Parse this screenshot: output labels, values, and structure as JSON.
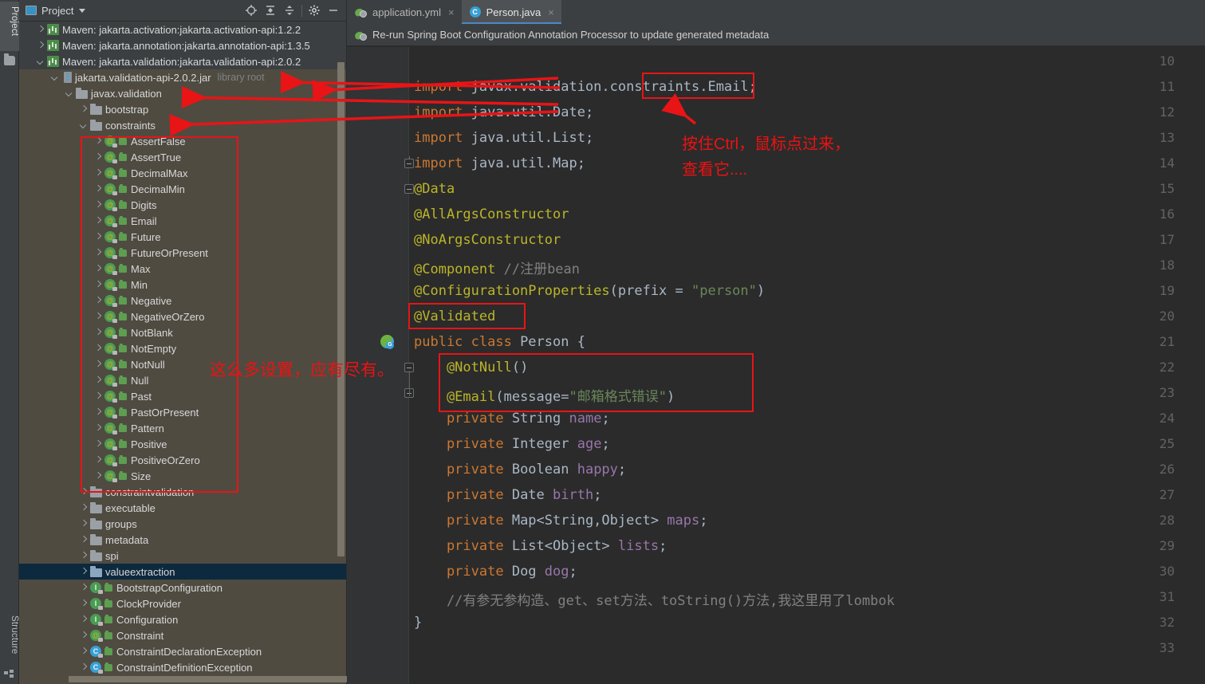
{
  "rail": {
    "top_tab": "Project",
    "bottom_tab": "Structure",
    "folder_icon": "folder-icon",
    "structure_icon": "structure-icon"
  },
  "project_panel": {
    "title": "Project",
    "toolbar": [
      {
        "name": "select-opened-file-icon",
        "glyph": "target"
      },
      {
        "name": "expand-all-icon",
        "glyph": "expand"
      },
      {
        "name": "collapse-all-icon",
        "glyph": "collapse"
      },
      {
        "name": "settings-gear-icon",
        "glyph": "gear"
      },
      {
        "name": "hide-panel-icon",
        "glyph": "minus"
      }
    ],
    "tree": [
      {
        "label": "Maven: jakarta.activation:jakarta.activation-api:1.2.2",
        "indent": 0,
        "arrow": "right",
        "icon": "maven",
        "bg": "dark"
      },
      {
        "label": "Maven: jakarta.annotation:jakarta.annotation-api:1.3.5",
        "indent": 0,
        "arrow": "right",
        "icon": "maven",
        "bg": "dark"
      },
      {
        "label": "Maven: jakarta.validation:jakarta.validation-api:2.0.2",
        "indent": 0,
        "arrow": "down",
        "icon": "maven",
        "bg": "dark"
      },
      {
        "label": "jakarta.validation-api-2.0.2.jar",
        "sub": "library root",
        "indent": 1,
        "arrow": "down",
        "icon": "jar",
        "bg": "olive"
      },
      {
        "label": "javax.validation",
        "indent": 2,
        "arrow": "down",
        "icon": "folder",
        "bg": "olive"
      },
      {
        "label": "bootstrap",
        "indent": 3,
        "arrow": "right",
        "icon": "folder",
        "bg": "olive"
      },
      {
        "label": "constraints",
        "indent": 3,
        "arrow": "down",
        "icon": "folder",
        "bg": "olive"
      },
      {
        "label": "AssertFalse",
        "indent": 4,
        "arrow": "right",
        "icon": "ann",
        "bg": "olive"
      },
      {
        "label": "AssertTrue",
        "indent": 4,
        "arrow": "right",
        "icon": "ann",
        "bg": "olive"
      },
      {
        "label": "DecimalMax",
        "indent": 4,
        "arrow": "right",
        "icon": "ann",
        "bg": "olive"
      },
      {
        "label": "DecimalMin",
        "indent": 4,
        "arrow": "right",
        "icon": "ann",
        "bg": "olive"
      },
      {
        "label": "Digits",
        "indent": 4,
        "arrow": "right",
        "icon": "ann",
        "bg": "olive"
      },
      {
        "label": "Email",
        "indent": 4,
        "arrow": "right",
        "icon": "ann",
        "bg": "olive"
      },
      {
        "label": "Future",
        "indent": 4,
        "arrow": "right",
        "icon": "ann",
        "bg": "olive"
      },
      {
        "label": "FutureOrPresent",
        "indent": 4,
        "arrow": "right",
        "icon": "ann",
        "bg": "olive"
      },
      {
        "label": "Max",
        "indent": 4,
        "arrow": "right",
        "icon": "ann",
        "bg": "olive"
      },
      {
        "label": "Min",
        "indent": 4,
        "arrow": "right",
        "icon": "ann",
        "bg": "olive"
      },
      {
        "label": "Negative",
        "indent": 4,
        "arrow": "right",
        "icon": "ann",
        "bg": "olive"
      },
      {
        "label": "NegativeOrZero",
        "indent": 4,
        "arrow": "right",
        "icon": "ann",
        "bg": "olive"
      },
      {
        "label": "NotBlank",
        "indent": 4,
        "arrow": "right",
        "icon": "ann",
        "bg": "olive"
      },
      {
        "label": "NotEmpty",
        "indent": 4,
        "arrow": "right",
        "icon": "ann",
        "bg": "olive"
      },
      {
        "label": "NotNull",
        "indent": 4,
        "arrow": "right",
        "icon": "ann",
        "bg": "olive"
      },
      {
        "label": "Null",
        "indent": 4,
        "arrow": "right",
        "icon": "ann",
        "bg": "olive"
      },
      {
        "label": "Past",
        "indent": 4,
        "arrow": "right",
        "icon": "ann",
        "bg": "olive"
      },
      {
        "label": "PastOrPresent",
        "indent": 4,
        "arrow": "right",
        "icon": "ann",
        "bg": "olive"
      },
      {
        "label": "Pattern",
        "indent": 4,
        "arrow": "right",
        "icon": "ann",
        "bg": "olive"
      },
      {
        "label": "Positive",
        "indent": 4,
        "arrow": "right",
        "icon": "ann",
        "bg": "olive"
      },
      {
        "label": "PositiveOrZero",
        "indent": 4,
        "arrow": "right",
        "icon": "ann",
        "bg": "olive"
      },
      {
        "label": "Size",
        "indent": 4,
        "arrow": "right",
        "icon": "ann",
        "bg": "olive"
      },
      {
        "label": "constraintvalidation",
        "indent": 3,
        "arrow": "right",
        "icon": "folder",
        "bg": "olive"
      },
      {
        "label": "executable",
        "indent": 3,
        "arrow": "right",
        "icon": "folder",
        "bg": "olive"
      },
      {
        "label": "groups",
        "indent": 3,
        "arrow": "right",
        "icon": "folder",
        "bg": "olive"
      },
      {
        "label": "metadata",
        "indent": 3,
        "arrow": "right",
        "icon": "folder",
        "bg": "olive"
      },
      {
        "label": "spi",
        "indent": 3,
        "arrow": "right",
        "icon": "folder",
        "bg": "olive"
      },
      {
        "label": "valueextraction",
        "indent": 3,
        "arrow": "right",
        "icon": "folder-blue",
        "bg": "selected"
      },
      {
        "label": "BootstrapConfiguration",
        "indent": 3,
        "arrow": "right",
        "icon": "intf",
        "bg": "olive"
      },
      {
        "label": "ClockProvider",
        "indent": 3,
        "arrow": "right",
        "icon": "intf",
        "bg": "olive"
      },
      {
        "label": "Configuration",
        "indent": 3,
        "arrow": "right",
        "icon": "intf",
        "bg": "olive"
      },
      {
        "label": "Constraint",
        "indent": 3,
        "arrow": "right",
        "icon": "ann",
        "bg": "olive"
      },
      {
        "label": "ConstraintDeclarationException",
        "indent": 3,
        "arrow": "right",
        "icon": "cls",
        "bg": "olive"
      },
      {
        "label": "ConstraintDefinitionException",
        "indent": 3,
        "arrow": "right",
        "icon": "cls",
        "bg": "olive"
      }
    ]
  },
  "editor": {
    "tabs": [
      {
        "label": "application.yml",
        "icon": "spring-yml-icon",
        "active": false,
        "close": "×"
      },
      {
        "label": "Person.java",
        "icon": "java-class-icon",
        "active": true,
        "close": "×"
      }
    ],
    "notification": "Re-run Spring Boot Configuration Annotation Processor to update generated metadata",
    "notification_icon": "spring-leaf-icon",
    "first_line": 10,
    "lines": [
      {
        "n": 10,
        "tokens": []
      },
      {
        "n": 11,
        "tokens": [
          {
            "t": "import ",
            "c": "kw"
          },
          {
            "t": "javax.validation.constraints.Email;",
            "c": "pln"
          }
        ]
      },
      {
        "n": 12,
        "tokens": [
          {
            "t": "import ",
            "c": "kw"
          },
          {
            "t": "java.util.Date;",
            "c": "pln"
          }
        ]
      },
      {
        "n": 13,
        "tokens": [
          {
            "t": "import ",
            "c": "kw"
          },
          {
            "t": "java.util.List;",
            "c": "pln"
          }
        ]
      },
      {
        "n": 14,
        "tokens": [
          {
            "t": "import ",
            "c": "kw"
          },
          {
            "t": "java.util.Map;",
            "c": "pln"
          }
        ]
      },
      {
        "n": 15,
        "tokens": [
          {
            "t": "@Data",
            "c": "ann"
          }
        ]
      },
      {
        "n": 16,
        "tokens": [
          {
            "t": "@AllArgsConstructor",
            "c": "ann"
          }
        ]
      },
      {
        "n": 17,
        "tokens": [
          {
            "t": "@NoArgsConstructor",
            "c": "ann"
          }
        ]
      },
      {
        "n": 18,
        "tokens": [
          {
            "t": "@Component ",
            "c": "ann"
          },
          {
            "t": "//注册bean",
            "c": "cmt"
          }
        ]
      },
      {
        "n": 19,
        "tokens": [
          {
            "t": "@ConfigurationProperties",
            "c": "ann"
          },
          {
            "t": "(prefix = ",
            "c": "pln"
          },
          {
            "t": "\"person\"",
            "c": "str"
          },
          {
            "t": ")",
            "c": "pln"
          }
        ]
      },
      {
        "n": 20,
        "tokens": [
          {
            "t": "@Validated",
            "c": "ann"
          }
        ]
      },
      {
        "n": 21,
        "tokens": [
          {
            "t": "public class ",
            "c": "kw"
          },
          {
            "t": "Person ",
            "c": "pln"
          },
          {
            "t": "{",
            "c": "pln"
          }
        ]
      },
      {
        "n": 22,
        "tokens": [
          {
            "t": "    @NotNull",
            "c": "ann"
          },
          {
            "t": "()",
            "c": "pln"
          }
        ]
      },
      {
        "n": 23,
        "tokens": [
          {
            "t": "    @Email",
            "c": "ann"
          },
          {
            "t": "(message=",
            "c": "pln"
          },
          {
            "t": "\"邮箱格式错误\"",
            "c": "str"
          },
          {
            "t": ")",
            "c": "pln"
          }
        ]
      },
      {
        "n": 24,
        "tokens": [
          {
            "t": "    private ",
            "c": "kw"
          },
          {
            "t": "String ",
            "c": "typ"
          },
          {
            "t": "name",
            "c": "fld"
          },
          {
            "t": ";",
            "c": "pln"
          }
        ]
      },
      {
        "n": 25,
        "tokens": [
          {
            "t": "    private ",
            "c": "kw"
          },
          {
            "t": "Integer ",
            "c": "typ"
          },
          {
            "t": "age",
            "c": "fld"
          },
          {
            "t": ";",
            "c": "pln"
          }
        ]
      },
      {
        "n": 26,
        "tokens": [
          {
            "t": "    private ",
            "c": "kw"
          },
          {
            "t": "Boolean ",
            "c": "typ"
          },
          {
            "t": "happy",
            "c": "fld"
          },
          {
            "t": ";",
            "c": "pln"
          }
        ]
      },
      {
        "n": 27,
        "tokens": [
          {
            "t": "    private ",
            "c": "kw"
          },
          {
            "t": "Date ",
            "c": "typ"
          },
          {
            "t": "birth",
            "c": "fld"
          },
          {
            "t": ";",
            "c": "pln"
          }
        ]
      },
      {
        "n": 28,
        "tokens": [
          {
            "t": "    private ",
            "c": "kw"
          },
          {
            "t": "Map<String,Object> ",
            "c": "typ"
          },
          {
            "t": "maps",
            "c": "fld"
          },
          {
            "t": ";",
            "c": "pln"
          }
        ]
      },
      {
        "n": 29,
        "tokens": [
          {
            "t": "    private ",
            "c": "kw"
          },
          {
            "t": "List<Object> ",
            "c": "typ"
          },
          {
            "t": "lists",
            "c": "fld"
          },
          {
            "t": ";",
            "c": "pln"
          }
        ]
      },
      {
        "n": 30,
        "tokens": [
          {
            "t": "    private ",
            "c": "kw"
          },
          {
            "t": "Dog ",
            "c": "typ"
          },
          {
            "t": "dog",
            "c": "fld"
          },
          {
            "t": ";",
            "c": "pln"
          }
        ]
      },
      {
        "n": 31,
        "tokens": [
          {
            "t": "    //有参无参构造、get、set方法、toString()方法,我这里用了lombok",
            "c": "cmt"
          }
        ]
      },
      {
        "n": 32,
        "tokens": [
          {
            "t": "}",
            "c": "pln"
          }
        ]
      },
      {
        "n": 33,
        "tokens": []
      }
    ]
  },
  "annotations": {
    "note_ctrl": "按住Ctrl，鼠标点过来，",
    "note_ctrl2": "查看它....",
    "note_settings": "这么多设置，应有尽有。",
    "color": "#ee1111"
  }
}
